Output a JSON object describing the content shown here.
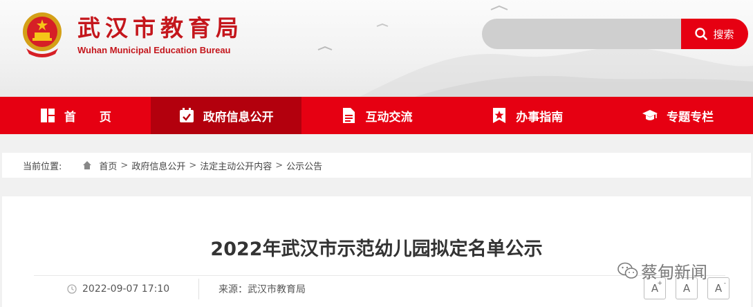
{
  "header": {
    "title": "武汉市教育局",
    "subtitle": "Wuhan Municipal Education Bureau",
    "search": {
      "placeholder": "",
      "button_label": "搜索"
    }
  },
  "nav": {
    "items": [
      {
        "label": "首　　页",
        "icon": "grid-icon"
      },
      {
        "label": "政府信息公开",
        "icon": "calendar-check-icon"
      },
      {
        "label": "互动交流",
        "icon": "document-icon"
      },
      {
        "label": "办事指南",
        "icon": "star-bookmark-icon"
      },
      {
        "label": "专题专栏",
        "icon": "graduation-cap-icon"
      }
    ],
    "active_index": 1
  },
  "breadcrumb": {
    "label": "当前位置:",
    "items": [
      "首页",
      "政府信息公开",
      "法定主动公开内容",
      "公示公告"
    ]
  },
  "article": {
    "title": "2022年武汉市示范幼儿园拟定名单公示",
    "date": "2022-09-07 17:10",
    "source": "来源：武汉市教育局",
    "font_buttons": [
      "A+",
      "A",
      "A-"
    ]
  },
  "watermark": "蔡甸新闻",
  "colors": {
    "primary": "#e60012",
    "active_nav": "#b3000d",
    "title_red": "#c4161c"
  }
}
